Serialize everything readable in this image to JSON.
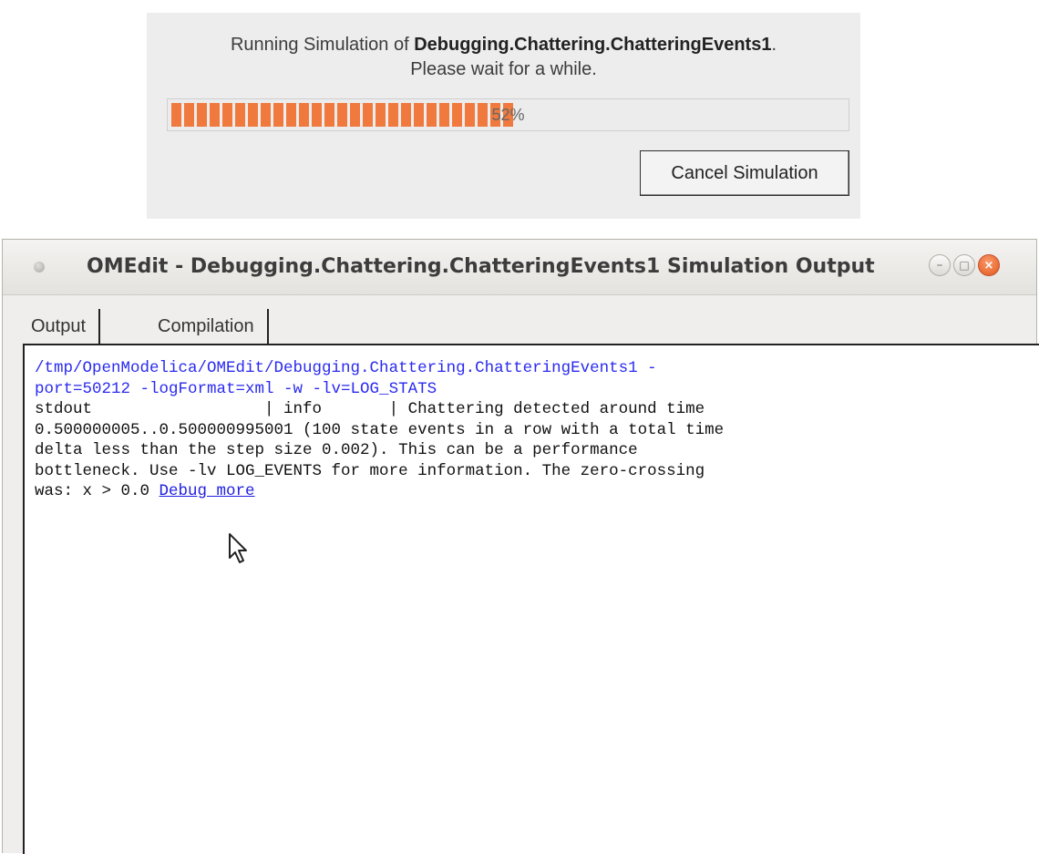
{
  "progress_dialog": {
    "message_prefix": "Running Simulation of ",
    "model_name": "Debugging.Chattering.ChatteringEvents1",
    "message_suffix": ".",
    "message_line2": "Please wait for a while.",
    "progress_value": 0.52,
    "progress_text": "52%",
    "cancel_label": "Cancel Simulation",
    "bar_color": "#f07a3e"
  },
  "output_window": {
    "title": "OMEdit - Debugging.Chattering.ChatteringEvents1 Simulation Output",
    "controls": {
      "minimize": "–",
      "maximize": "□",
      "close": "×"
    },
    "tabs": [
      {
        "label": "Output",
        "active": true
      },
      {
        "label": "Compilation",
        "active": false
      }
    ],
    "output": {
      "command_line1": "/tmp/OpenModelica/OMEdit/Debugging.Chattering.ChatteringEvents1 -",
      "command_line2": "port=50212 -logFormat=xml -w -lv=LOG_STATS",
      "log_line1": "stdout                  | info       | Chattering detected around time",
      "log_line2": "0.500000005..0.500000995001 (100 state events in a row with a total time",
      "log_line3": "delta less than the step size 0.002). This can be a performance",
      "log_line4": "bottleneck. Use -lv LOG_EVENTS for more information. The zero-crossing",
      "log_line5_prefix": "was: x > 0.0 ",
      "debug_link": "Debug more",
      "command_color": "#2a2af0"
    }
  }
}
